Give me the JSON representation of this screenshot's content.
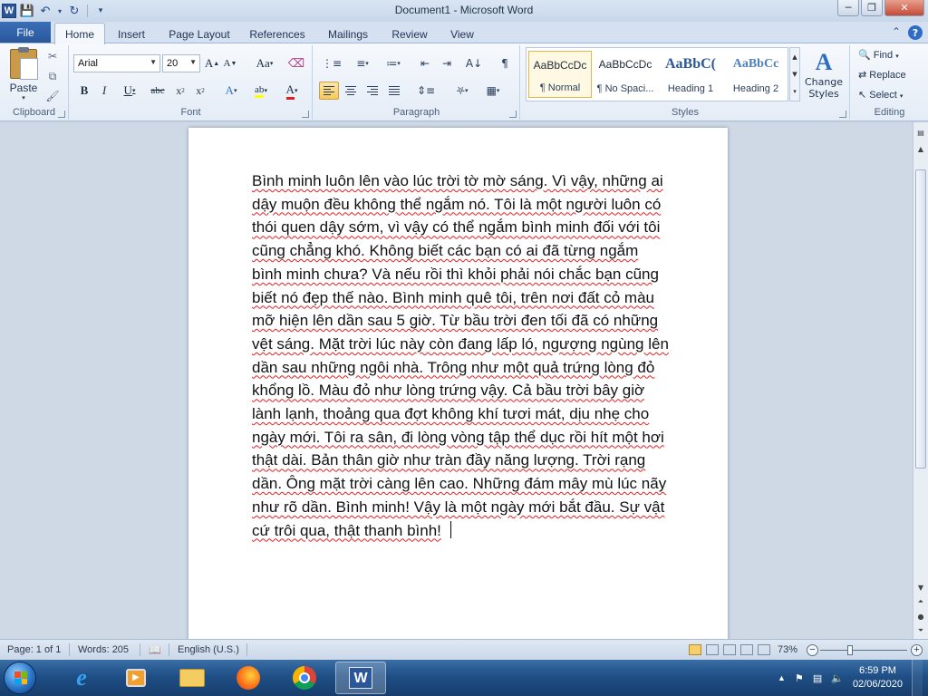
{
  "window": {
    "title": "Document1 - Microsoft Word"
  },
  "ribbon": {
    "file_tab": "File",
    "tabs": [
      "Home",
      "Insert",
      "Page Layout",
      "References",
      "Mailings",
      "Review",
      "View"
    ],
    "active_tab": "Home",
    "clipboard": {
      "paste_label": "Paste",
      "group_label": "Clipboard"
    },
    "font": {
      "font_name": "Arial",
      "font_size": "20",
      "group_label": "Font"
    },
    "paragraph": {
      "group_label": "Paragraph"
    },
    "styles": {
      "group_label": "Styles",
      "items": [
        {
          "sample": "AaBbCcDc",
          "name": "¶ Normal"
        },
        {
          "sample": "AaBbCcDc",
          "name": "¶ No Spaci..."
        },
        {
          "sample": "AaBbC(",
          "name": "Heading 1"
        },
        {
          "sample": "AaBbCc",
          "name": "Heading 2"
        }
      ],
      "change_styles": "Change Styles"
    },
    "editing": {
      "group_label": "Editing",
      "find": "Find",
      "replace": "Replace",
      "select": "Select"
    }
  },
  "document": {
    "text": "Bình minh luôn lên vào lúc trời tờ mờ sáng. Vì vậy, những ai dậy muộn đều không thể ngắm nó. Tôi là một người luôn có thói quen dậy sớm, vì vậy có thể ngắm bình minh đối với tôi cũng chẳng khó. Không biết các bạn có ai đã từng ngắm bình minh chưa? Và nếu rồi thì khỏi phải nói chắc bạn cũng biết nó đẹp thế nào. Bình minh quê tôi, trên nơi đất cỏ màu mỡ hiện lên dần sau 5 giờ. Từ bầu trời đen tối đã có những vệt sáng. Mặt trời lúc này còn đang lấp ló, ngượng ngùng lên dần sau những ngôi nhà. Trông như một quả trứng lòng đỏ khổng lồ. Màu đỏ như lòng trứng vậy. Cả bầu trời bây giờ lành lạnh, thoảng qua đợt không khí tươi mát, dịu nhẹ cho ngày mới. Tôi ra sân, đi lòng vòng tập thể dục rồi hít một hơi thật dài. Bản thân giờ như tràn đầy năng lượng. Trời rạng dần. Ông mặt trời càng lên cao. Những đám mây mù lúc nãy như rõ dần. Bình minh! Vậy là một ngày mới bắt đầu. Sự vật cứ trôi qua, thật thanh bình!"
  },
  "statusbar": {
    "page": "Page: 1 of 1",
    "words": "Words: 205",
    "language": "English (U.S.)",
    "zoom": "73%"
  },
  "taskbar": {
    "time": "6:59 PM",
    "date": "02/06/2020"
  },
  "colors": {
    "file_tab": "#2a579a",
    "spell_underline": "#e02020",
    "taskbar": "#1f4f86"
  }
}
